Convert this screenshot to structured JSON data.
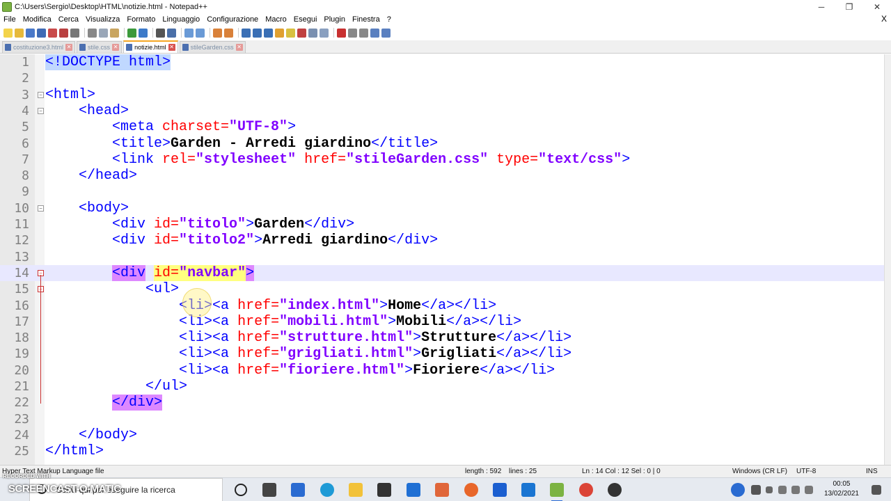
{
  "window": {
    "title": "C:\\Users\\Sergio\\Desktop\\HTML\\notizie.html - Notepad++",
    "minimize": "─",
    "maximize": "❐",
    "close": "✕"
  },
  "menu": {
    "items": [
      "File",
      "Modifica",
      "Cerca",
      "Visualizza",
      "Formato",
      "Linguaggio",
      "Configurazione",
      "Macro",
      "Esegui",
      "Plugin",
      "Finestra",
      "?"
    ],
    "close_doc": "X"
  },
  "tabs": [
    {
      "label": "costituzione3.html",
      "active": false
    },
    {
      "label": "stile.css",
      "active": false
    },
    {
      "label": "notizie.html",
      "active": true
    },
    {
      "label": "stileGarden.css",
      "active": false
    }
  ],
  "editor": {
    "current_line": 14,
    "lines": [
      {
        "n": "1"
      },
      {
        "n": "2"
      },
      {
        "n": "3"
      },
      {
        "n": "4"
      },
      {
        "n": "5"
      },
      {
        "n": "6"
      },
      {
        "n": "7"
      },
      {
        "n": "8"
      },
      {
        "n": "9"
      },
      {
        "n": "10"
      },
      {
        "n": "11"
      },
      {
        "n": "12"
      },
      {
        "n": "13"
      },
      {
        "n": "14"
      },
      {
        "n": "15"
      },
      {
        "n": "16"
      },
      {
        "n": "17"
      },
      {
        "n": "18"
      },
      {
        "n": "19"
      },
      {
        "n": "20"
      },
      {
        "n": "21"
      },
      {
        "n": "22"
      },
      {
        "n": "23"
      },
      {
        "n": "24"
      },
      {
        "n": "25"
      }
    ],
    "code": {
      "l1": "<!DOCTYPE html>",
      "l3": "<html>",
      "l4": "<head>",
      "l5a": "<meta ",
      "l5b": "charset=",
      "l5c": "\"UTF-8\"",
      "l5d": ">",
      "l6a": "<title>",
      "l6b": "Garden - Arredi giardino",
      "l6c": "</title>",
      "l7a": "<link ",
      "l7b": "rel=",
      "l7c": "\"stylesheet\"",
      "l7d": " href=",
      "l7e": "\"stileGarden.css\"",
      "l7f": " type=",
      "l7g": "\"text/css\"",
      "l7h": ">",
      "l8": "</head>",
      "l10": "<body>",
      "l11a": "<div ",
      "l11b": "id=",
      "l11c": "\"titolo\"",
      "l11d": ">",
      "l11e": "Garden",
      "l11f": "</div>",
      "l12a": "<div ",
      "l12b": "id=",
      "l12c": "\"titolo2\"",
      "l12d": ">",
      "l12e": "Arredi giardino",
      "l12f": "</div>",
      "l14a": "<div",
      "l14b": " ",
      "l14c": "id=",
      "l14d": "\"navbar\"",
      "l14e": ">",
      "l15": "<ul>",
      "l16a": "<li>",
      "l16b": "<a ",
      "l16c": "href=",
      "l16d": "\"index.html\"",
      "l16e": ">",
      "l16f": "Home",
      "l16g": "</a></li>",
      "l17a": "<li>",
      "l17b": "<a ",
      "l17c": "href=",
      "l17d": "\"mobili.html\"",
      "l17e": ">",
      "l17f": "Mobili",
      "l17g": "</a></li>",
      "l18a": "<li>",
      "l18b": "<a ",
      "l18c": "href=",
      "l18d": "\"strutture.html\"",
      "l18e": ">",
      "l18f": "Strutture",
      "l18g": "</a></li>",
      "l19a": "<li>",
      "l19b": "<a ",
      "l19c": "href=",
      "l19d": "\"grigliati.html\"",
      "l19e": ">",
      "l19f": "Grigliati",
      "l19g": "</a></li>",
      "l20a": "<li>",
      "l20b": "<a ",
      "l20c": "href=",
      "l20d": "\"fioriere.html\"",
      "l20e": ">",
      "l20f": "Fioriere",
      "l20g": "</a></li>",
      "l21": "</ul>",
      "l22": "</div>",
      "l24": "</body>",
      "l25": "</html>"
    }
  },
  "status": {
    "language": "Hyper Text Markup Language file",
    "length": "length : 592",
    "lines": "lines : 25",
    "position": "Ln : 14    Col : 12    Sel : 0 | 0",
    "eol": "Windows (CR LF)",
    "encoding": "UTF-8",
    "mode": "INS"
  },
  "taskbar": {
    "search_placeholder": "Scrivi qui per eseguire la ricerca",
    "time": "00:05",
    "date": "13/02/2021",
    "watermark_top": "RECORDED WITH",
    "watermark": "SCREENCAST-O-MATIC"
  },
  "colors": {
    "tag": "#0000ff",
    "attribute": "#ff0000",
    "value": "#8000ff",
    "text": "#000000",
    "current_line": "#e8e8ff",
    "brace_match": "#dd88ff",
    "smart_highlight": "#ffff80",
    "active_tab_accent": "#f5a623"
  }
}
